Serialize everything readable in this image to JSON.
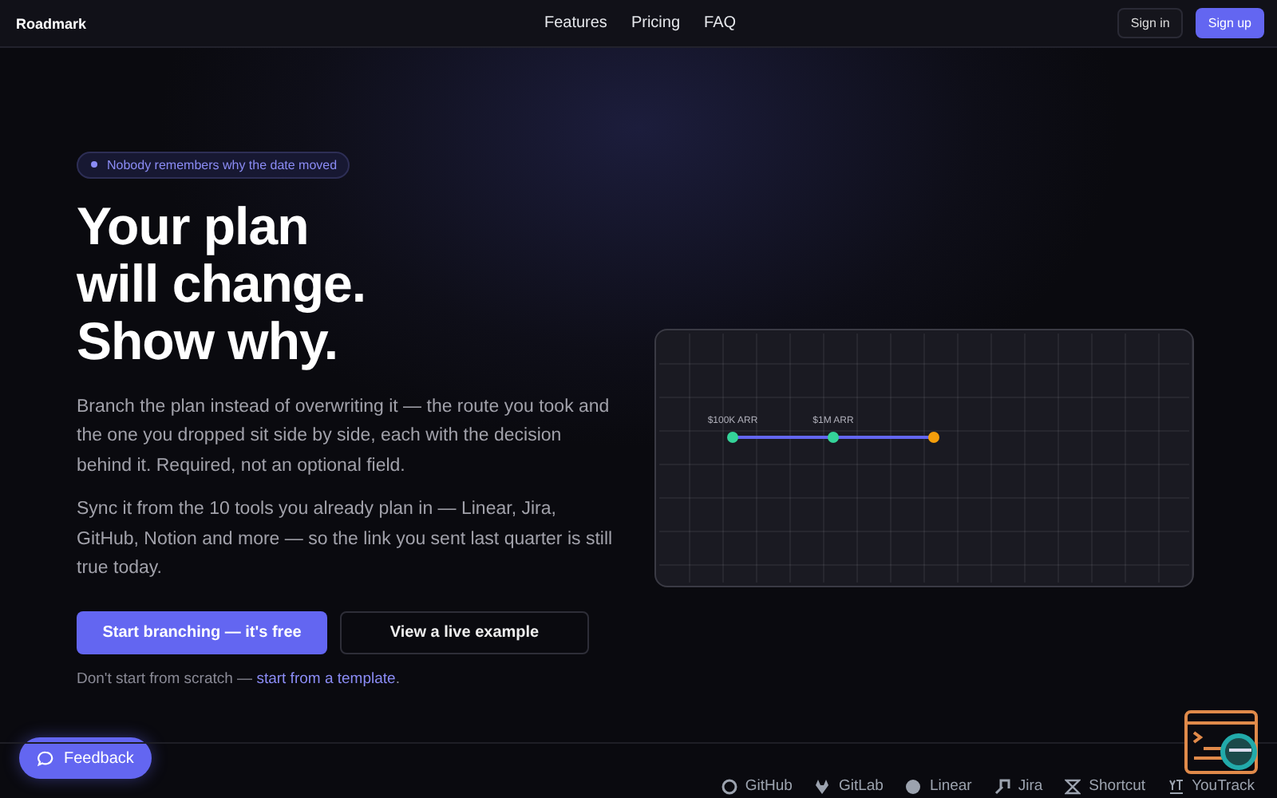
{
  "header": {
    "logo": "Roadmark",
    "nav": [
      "Features",
      "Pricing",
      "FAQ"
    ],
    "sign_in": "Sign in",
    "sign_up": "Sign up"
  },
  "hero": {
    "badge": "Nobody remembers why the date moved",
    "title_lines": [
      "Your plan",
      "will change.",
      "Show why."
    ],
    "paragraphs": [
      "Branch the plan instead of overwriting it — the route you took and the one you dropped sit side by side, each with the decision behind it. Required, not an optional field.",
      "Sync it from the 10 tools you already plan in — Linear, Jira, GitHub, Notion and more — so the link you sent last quarter is still true today."
    ],
    "primary_button": "Start branching — it's free",
    "secondary_button": "View a live example",
    "template_prefix": "Don't start from scratch — ",
    "template_link": "start from a template",
    "template_suffix": "."
  },
  "timeline": {
    "nodes": [
      {
        "label": "$100K ARR",
        "color": "#34d399"
      },
      {
        "label": "$1M ARR",
        "color": "#34d399"
      },
      {
        "color": "#f59e0b"
      }
    ]
  },
  "feedback": "Feedback",
  "integrations": [
    {
      "kind": "github",
      "name": "GitHub"
    },
    {
      "kind": "gitlab",
      "name": "GitLab"
    },
    {
      "kind": "linear",
      "name": "Linear"
    },
    {
      "kind": "jira",
      "name": "Jira"
    },
    {
      "kind": "shortcut",
      "name": "Shortcut"
    },
    {
      "kind": "youtrack",
      "name": "YouTrack"
    }
  ]
}
